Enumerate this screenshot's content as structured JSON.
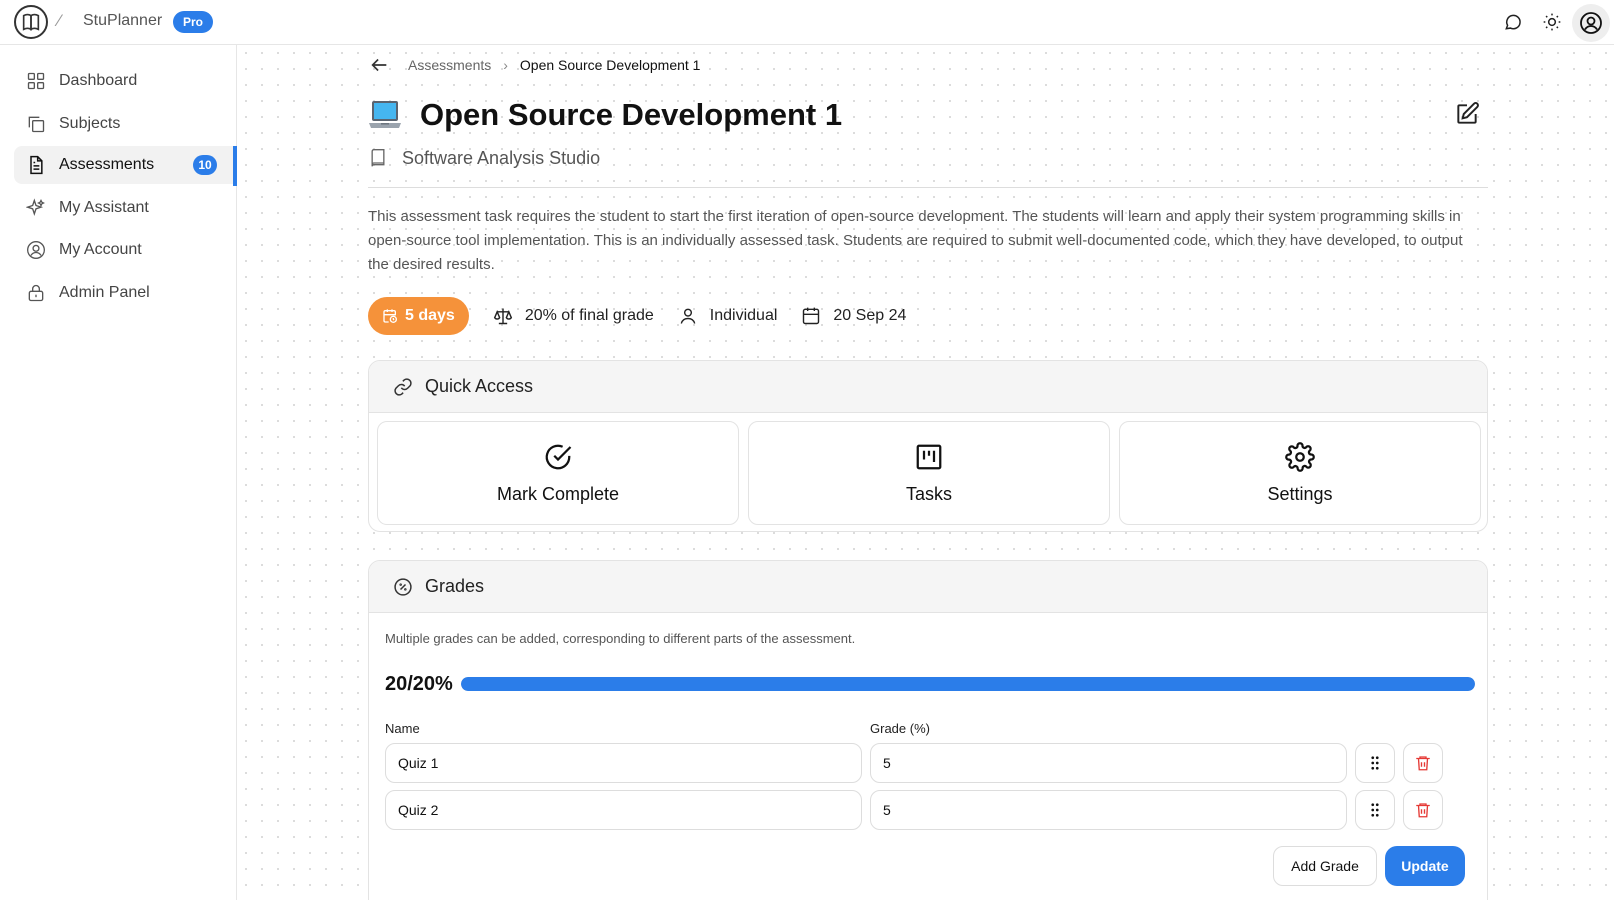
{
  "app": {
    "name": "StuPlanner",
    "plan_badge": "Pro"
  },
  "sidebar": {
    "items": [
      {
        "label": "Dashboard",
        "icon": "grid-icon"
      },
      {
        "label": "Subjects",
        "icon": "copy-icon"
      },
      {
        "label": "Assessments",
        "icon": "document-icon",
        "badge": "10",
        "active": true
      },
      {
        "label": "My Assistant",
        "icon": "sparkles-icon"
      },
      {
        "label": "My Account",
        "icon": "user-circle-icon"
      },
      {
        "label": "Admin Panel",
        "icon": "lock-icon"
      }
    ]
  },
  "breadcrumb": {
    "parent": "Assessments",
    "separator": "›",
    "current": "Open Source Development 1"
  },
  "assessment": {
    "title": "Open Source Development 1",
    "subject": "Software Analysis Studio",
    "description": "This assessment task requires the student to start the first iteration of open-source development. The students will learn and apply their system programming skills in open-source tool implementation. This is an individually assessed task. Students are required to submit well-documented code, which they have developed, to output the desired results.",
    "due_in": "5 days",
    "weight": "20% of final grade",
    "type": "Individual",
    "due_date": "20 Sep 24"
  },
  "quick_access": {
    "title": "Quick Access",
    "tiles": [
      {
        "label": "Mark Complete",
        "icon": "check-circle-icon"
      },
      {
        "label": "Tasks",
        "icon": "kanban-icon"
      },
      {
        "label": "Settings",
        "icon": "gear-icon"
      }
    ]
  },
  "grades": {
    "title": "Grades",
    "hint": "Multiple grades can be added, corresponding to different parts of the assessment.",
    "progress_text": "20/20%",
    "progress_fraction": 1.0,
    "columns": {
      "name": "Name",
      "grade": "Grade (%)"
    },
    "rows": [
      {
        "name": "Quiz 1",
        "grade": "5"
      },
      {
        "name": "Quiz 2",
        "grade": "5"
      }
    ],
    "add_label": "Add Grade",
    "update_label": "Update"
  },
  "colors": {
    "accent": "#2b7de9",
    "due_pill": "#f5923a",
    "delete": "#e53935"
  }
}
